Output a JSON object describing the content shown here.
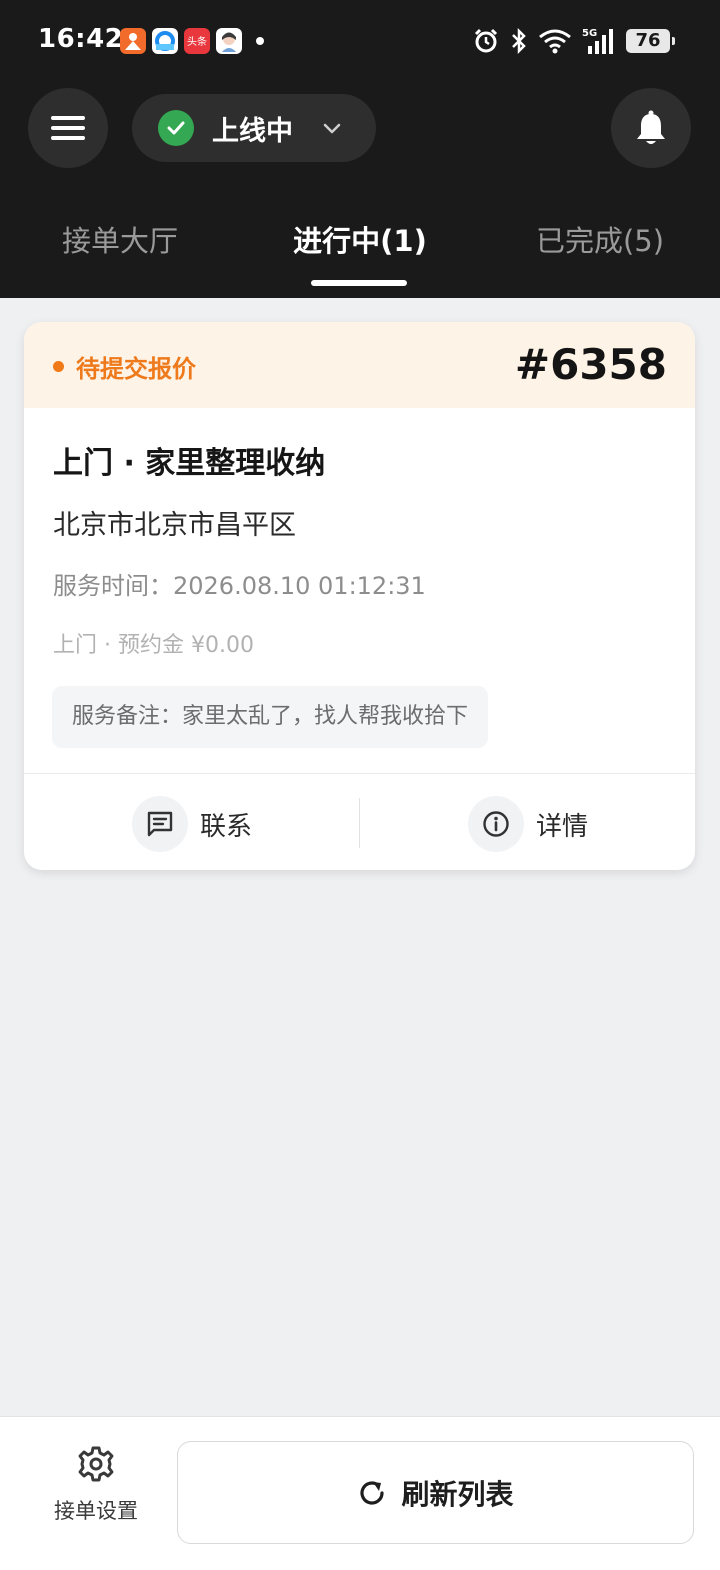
{
  "status_bar": {
    "time": "16:42",
    "network": "5G",
    "battery": "76",
    "app_icons": [
      "app-orange-icon",
      "app-blue-icon",
      "toutiao-icon",
      "avatar-app-icon"
    ],
    "toutiao_text": "头条"
  },
  "header": {
    "online_status": "上线中",
    "online_color": "#34a853"
  },
  "tabs": [
    {
      "label": "接单大厅",
      "active": false
    },
    {
      "label": "进行中(1)",
      "active": true
    },
    {
      "label": "已完成(5)",
      "active": false
    }
  ],
  "order": {
    "status": "待提交报价",
    "status_color": "#ee7a1c",
    "number": "#6358",
    "title": "上门 · 家里整理收纳",
    "address": "北京市北京市昌平区",
    "service_time": "服务时间：2026.08.10 01:12:31",
    "deposit": "上门 · 预约金 ¥0.00",
    "note": "服务备注：家里太乱了，找人帮我收拾下",
    "contact_label": "联系",
    "details_label": "详情"
  },
  "bottom_bar": {
    "settings_label": "接单设置",
    "refresh_label": "刷新列表"
  }
}
